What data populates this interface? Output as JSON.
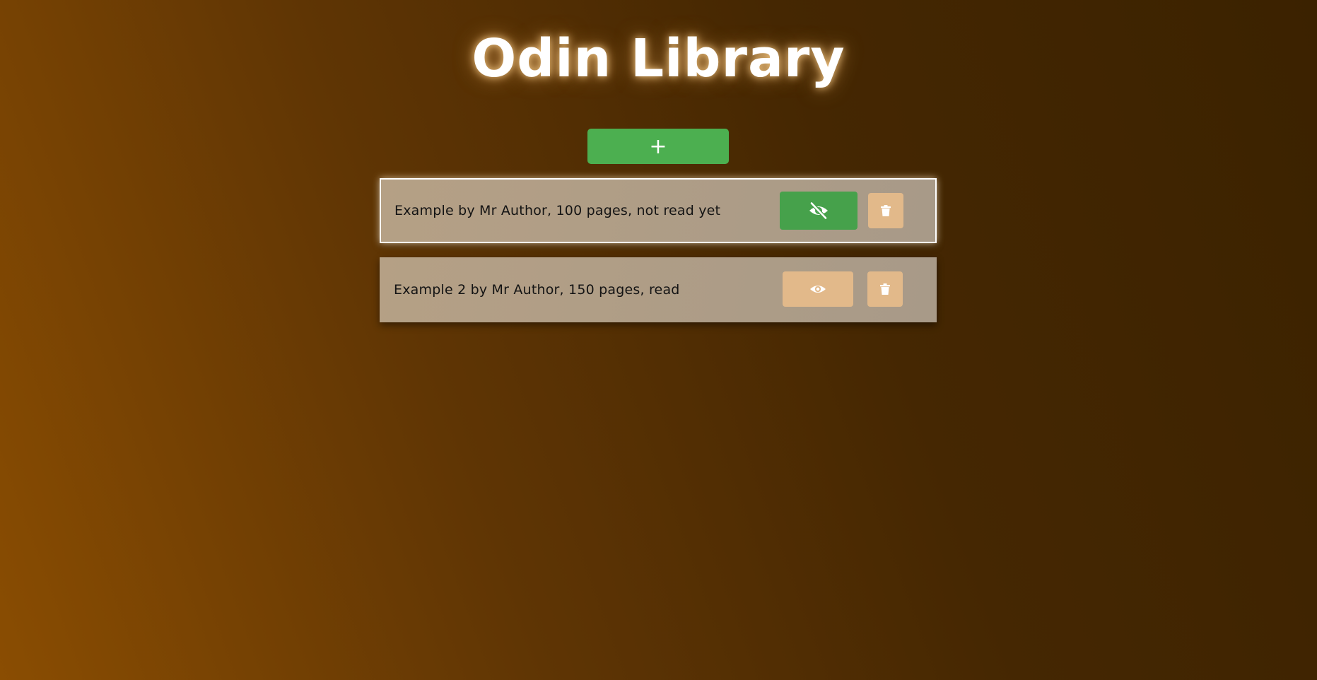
{
  "header": {
    "title": "Odin Library"
  },
  "toolbar": {
    "add_label": "+"
  },
  "books": [
    {
      "text": "Example by Mr Author, 100 pages, not read yet",
      "read": false,
      "toggle_icon": "eye-slash-icon",
      "delete_icon": "trash-icon"
    },
    {
      "text": "Example 2 by Mr Author, 150 pages, read",
      "read": true,
      "toggle_icon": "eye-icon",
      "delete_icon": "trash-icon"
    }
  ],
  "colors": {
    "accent_green": "#4caf50",
    "button_tan": "#e2b98a",
    "card_bg": "#b5a085",
    "title_text": "#ffffff"
  }
}
